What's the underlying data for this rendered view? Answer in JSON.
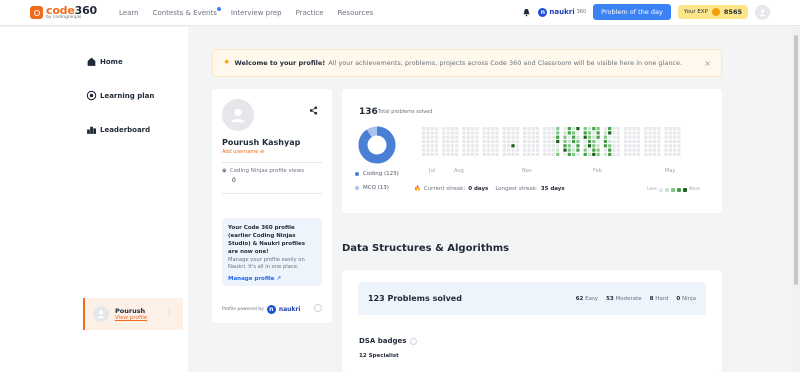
{
  "brand": {
    "name_prefix": "code",
    "name_suffix": "360",
    "sub": "by codingninjas"
  },
  "nav": [
    "Learn",
    "Contests & Events",
    "Interview prep",
    "Practice",
    "Resources"
  ],
  "header": {
    "naukri": "naukri",
    "naukri_suffix": "360",
    "potd": "Problem of the day",
    "exp_label": "Your EXP",
    "exp_value": "8565"
  },
  "sidebar": {
    "items": [
      {
        "label": "Home",
        "icon": "home-icon"
      },
      {
        "label": "Learning plan",
        "icon": "target-icon"
      },
      {
        "label": "Leaderboard",
        "icon": "leaderboard-icon"
      }
    ],
    "user": {
      "name": "Pourush",
      "link": "View profile"
    }
  },
  "banner": {
    "title": "Welcome to your profile!",
    "text": "All your achievements, problems, projects across Code 360 and Classroom will be visible here in one glance."
  },
  "profile": {
    "name": "Pourush Kashyap",
    "add_username": "Add username",
    "views_label": "Coding Ninjas profile views",
    "views_value": "0",
    "info_title": "Your Code 360 profile (earlier Coding Ninjas Studio) & Naukri profiles are now one!",
    "info_text": "Manage your profile easily on Naukri. It's all in one place.",
    "info_link": "Manage profile",
    "powered_by": "Profile powered by",
    "powered_brand": "naukri"
  },
  "stats": {
    "total": "136",
    "total_label": "Total problems solved",
    "legend": [
      {
        "label": "Coding (123)",
        "value": 123,
        "color": "#4a7fd6"
      },
      {
        "label": "MCQ (13)",
        "value": 13,
        "color": "#a9c4ee"
      }
    ],
    "months": [
      "Jul",
      "Aug",
      "Nov",
      "Feb",
      "May"
    ],
    "current_streak_label": "Current streak:",
    "current_streak": "0 days",
    "longest_streak_label": "Longest streak:",
    "longest_streak": "35 days",
    "less": "Less",
    "more": "More",
    "colors": {
      "empty": "#e6e8eb",
      "l1": "#c8e6c9",
      "l2": "#81c784",
      "l3": "#43a047",
      "l4": "#1b5e20"
    }
  },
  "dsa": {
    "section_title": "Data Structures & Algorithms",
    "solved": "123 Problems solved",
    "easy": "62",
    "easy_label": "Easy",
    "moderate": "53",
    "moderate_label": "Moderate",
    "hard": "8",
    "hard_label": "Hard",
    "ninja": "0",
    "ninja_label": "Ninja",
    "badges_title": "DSA badges",
    "specialist": "12 Specialist"
  }
}
